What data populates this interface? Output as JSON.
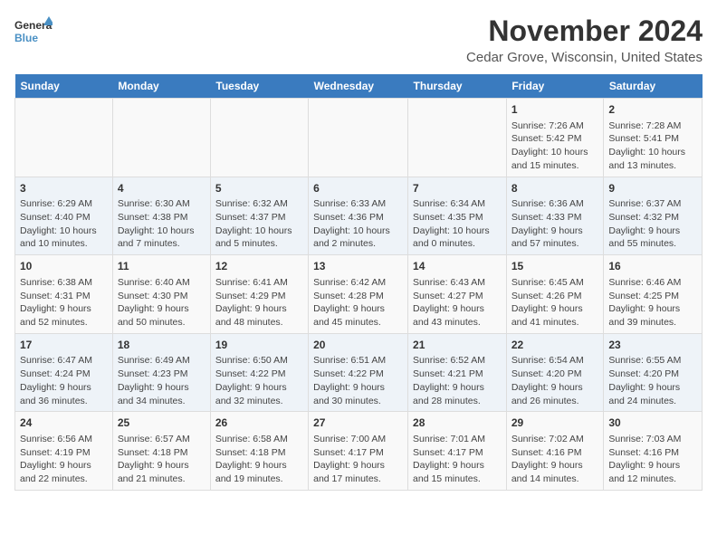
{
  "logo": {
    "line1": "General",
    "line2": "Blue"
  },
  "title": "November 2024",
  "subtitle": "Cedar Grove, Wisconsin, United States",
  "days_of_week": [
    "Sunday",
    "Monday",
    "Tuesday",
    "Wednesday",
    "Thursday",
    "Friday",
    "Saturday"
  ],
  "weeks": [
    [
      {
        "day": "",
        "info": ""
      },
      {
        "day": "",
        "info": ""
      },
      {
        "day": "",
        "info": ""
      },
      {
        "day": "",
        "info": ""
      },
      {
        "day": "",
        "info": ""
      },
      {
        "day": "1",
        "info": "Sunrise: 7:26 AM\nSunset: 5:42 PM\nDaylight: 10 hours and 15 minutes."
      },
      {
        "day": "2",
        "info": "Sunrise: 7:28 AM\nSunset: 5:41 PM\nDaylight: 10 hours and 13 minutes."
      }
    ],
    [
      {
        "day": "3",
        "info": "Sunrise: 6:29 AM\nSunset: 4:40 PM\nDaylight: 10 hours and 10 minutes."
      },
      {
        "day": "4",
        "info": "Sunrise: 6:30 AM\nSunset: 4:38 PM\nDaylight: 10 hours and 7 minutes."
      },
      {
        "day": "5",
        "info": "Sunrise: 6:32 AM\nSunset: 4:37 PM\nDaylight: 10 hours and 5 minutes."
      },
      {
        "day": "6",
        "info": "Sunrise: 6:33 AM\nSunset: 4:36 PM\nDaylight: 10 hours and 2 minutes."
      },
      {
        "day": "7",
        "info": "Sunrise: 6:34 AM\nSunset: 4:35 PM\nDaylight: 10 hours and 0 minutes."
      },
      {
        "day": "8",
        "info": "Sunrise: 6:36 AM\nSunset: 4:33 PM\nDaylight: 9 hours and 57 minutes."
      },
      {
        "day": "9",
        "info": "Sunrise: 6:37 AM\nSunset: 4:32 PM\nDaylight: 9 hours and 55 minutes."
      }
    ],
    [
      {
        "day": "10",
        "info": "Sunrise: 6:38 AM\nSunset: 4:31 PM\nDaylight: 9 hours and 52 minutes."
      },
      {
        "day": "11",
        "info": "Sunrise: 6:40 AM\nSunset: 4:30 PM\nDaylight: 9 hours and 50 minutes."
      },
      {
        "day": "12",
        "info": "Sunrise: 6:41 AM\nSunset: 4:29 PM\nDaylight: 9 hours and 48 minutes."
      },
      {
        "day": "13",
        "info": "Sunrise: 6:42 AM\nSunset: 4:28 PM\nDaylight: 9 hours and 45 minutes."
      },
      {
        "day": "14",
        "info": "Sunrise: 6:43 AM\nSunset: 4:27 PM\nDaylight: 9 hours and 43 minutes."
      },
      {
        "day": "15",
        "info": "Sunrise: 6:45 AM\nSunset: 4:26 PM\nDaylight: 9 hours and 41 minutes."
      },
      {
        "day": "16",
        "info": "Sunrise: 6:46 AM\nSunset: 4:25 PM\nDaylight: 9 hours and 39 minutes."
      }
    ],
    [
      {
        "day": "17",
        "info": "Sunrise: 6:47 AM\nSunset: 4:24 PM\nDaylight: 9 hours and 36 minutes."
      },
      {
        "day": "18",
        "info": "Sunrise: 6:49 AM\nSunset: 4:23 PM\nDaylight: 9 hours and 34 minutes."
      },
      {
        "day": "19",
        "info": "Sunrise: 6:50 AM\nSunset: 4:22 PM\nDaylight: 9 hours and 32 minutes."
      },
      {
        "day": "20",
        "info": "Sunrise: 6:51 AM\nSunset: 4:22 PM\nDaylight: 9 hours and 30 minutes."
      },
      {
        "day": "21",
        "info": "Sunrise: 6:52 AM\nSunset: 4:21 PM\nDaylight: 9 hours and 28 minutes."
      },
      {
        "day": "22",
        "info": "Sunrise: 6:54 AM\nSunset: 4:20 PM\nDaylight: 9 hours and 26 minutes."
      },
      {
        "day": "23",
        "info": "Sunrise: 6:55 AM\nSunset: 4:20 PM\nDaylight: 9 hours and 24 minutes."
      }
    ],
    [
      {
        "day": "24",
        "info": "Sunrise: 6:56 AM\nSunset: 4:19 PM\nDaylight: 9 hours and 22 minutes."
      },
      {
        "day": "25",
        "info": "Sunrise: 6:57 AM\nSunset: 4:18 PM\nDaylight: 9 hours and 21 minutes."
      },
      {
        "day": "26",
        "info": "Sunrise: 6:58 AM\nSunset: 4:18 PM\nDaylight: 9 hours and 19 minutes."
      },
      {
        "day": "27",
        "info": "Sunrise: 7:00 AM\nSunset: 4:17 PM\nDaylight: 9 hours and 17 minutes."
      },
      {
        "day": "28",
        "info": "Sunrise: 7:01 AM\nSunset: 4:17 PM\nDaylight: 9 hours and 15 minutes."
      },
      {
        "day": "29",
        "info": "Sunrise: 7:02 AM\nSunset: 4:16 PM\nDaylight: 9 hours and 14 minutes."
      },
      {
        "day": "30",
        "info": "Sunrise: 7:03 AM\nSunset: 4:16 PM\nDaylight: 9 hours and 12 minutes."
      }
    ]
  ]
}
